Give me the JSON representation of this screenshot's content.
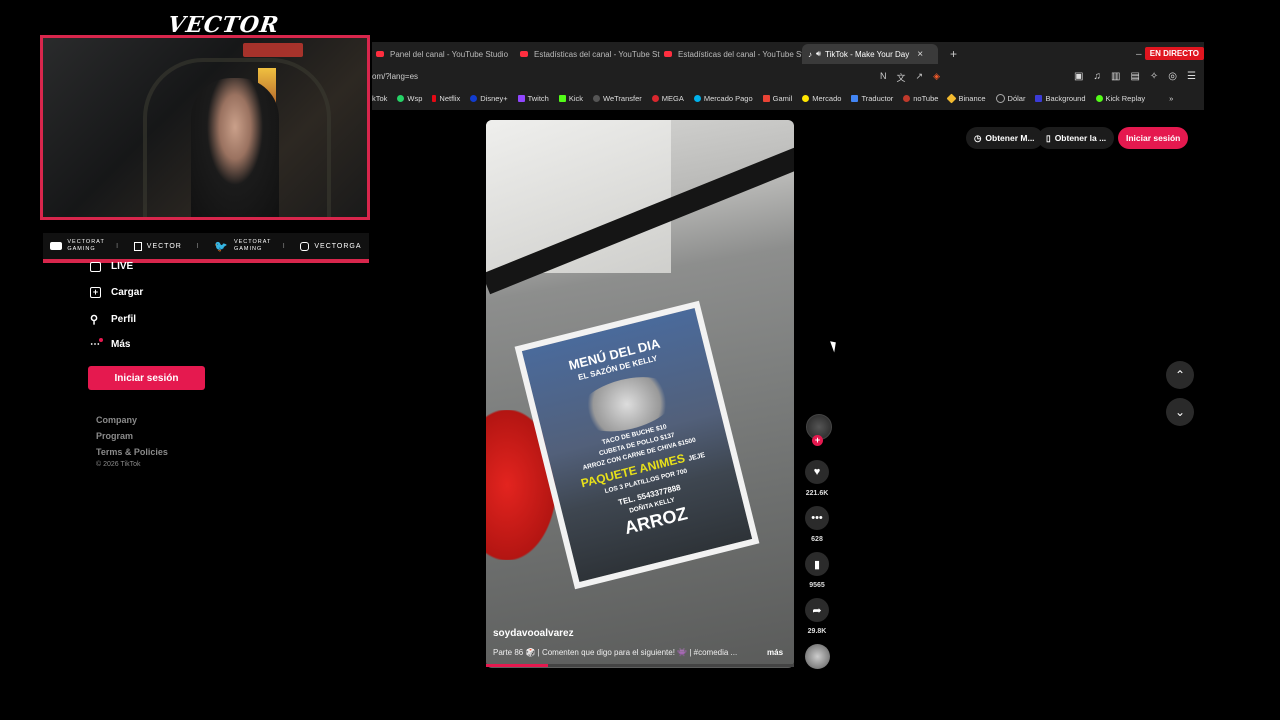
{
  "overlay": {
    "streamer_name": "VECTOR",
    "socials": [
      {
        "icon": "youtube-icon",
        "label": "VECTORAT GAMING"
      },
      {
        "icon": "twitch-icon",
        "label": "VECTOR"
      },
      {
        "icon": "twitter-icon",
        "label": "VECTORAT GAMING"
      },
      {
        "icon": "instagram-icon",
        "label": "VECTORGA"
      }
    ]
  },
  "browser": {
    "tabs": [
      {
        "label": "Panel del canal - YouTube Studio"
      },
      {
        "label": "Estadísticas del canal - YouTube Studio"
      },
      {
        "label": "Estadísticas del canal - YouTube Studio"
      },
      {
        "label": "TikTok - Make Your Day",
        "active": true
      }
    ],
    "live_badge": "EN DIRECTO",
    "url": "om/?lang=es",
    "bookmarks": [
      "kTok",
      "Wsp",
      "Netflix",
      "Disney+",
      "Twitch",
      "Kick",
      "WeTransfer",
      "MEGA",
      "Mercado Pago",
      "Gamil",
      "Mercado",
      "Traductor",
      "noTube",
      "Binance",
      "Dólar",
      "Background",
      "Kick Replay"
    ]
  },
  "sidebar": {
    "items": [
      {
        "icon": "live-icon",
        "label": "LIVE"
      },
      {
        "icon": "upload-icon",
        "label": "Cargar"
      },
      {
        "icon": "profile-icon",
        "label": "Perfil"
      },
      {
        "icon": "more-icon",
        "label": "Más"
      }
    ],
    "login_label": "Iniciar sesión",
    "footer": [
      "Company",
      "Program",
      "Terms & Policies"
    ],
    "copyright": "© 2026 TikTok"
  },
  "header": {
    "get_app_label": "Obtener M...",
    "get_desktop_label": "Obtener la ...",
    "login_label": "Iniciar sesión"
  },
  "video": {
    "flyer": {
      "title": "MENÚ DEL DIA",
      "subtitle": "EL SAZÓN DE KELLY",
      "line1": "TACO DE BUCHE $10",
      "line2": "CUBETA DE POLLO $137",
      "line3": "ARROZ CON CARNE DE CHIVA $1500",
      "promo": "PAQUETE ANIMES",
      "promo_note": "JEJE",
      "combo": "LOS 3 PLATILLOS POR 700",
      "phone": "TEL. 5543377888",
      "owner": "DOÑITA KELLY",
      "brand": "ARROZ"
    },
    "author": "soydavooalvarez",
    "caption": "Parte 86 🎲 | Comenten que digo para el siguiente! 👾 | #comedia ...",
    "more_label": "más",
    "progress": 0.2
  },
  "actions": {
    "likes": "221.6K",
    "comments": "628",
    "saves": "9565",
    "shares": "29.8K"
  },
  "colors": {
    "accent": "#e5194f",
    "overlay_red": "#d8264c",
    "live_red": "#e0151f"
  }
}
